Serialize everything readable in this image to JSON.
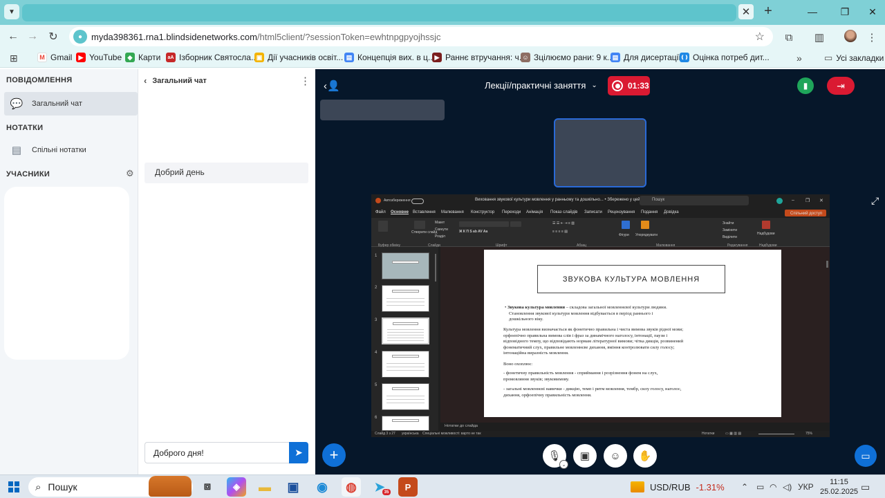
{
  "browser": {
    "tab_menu_icon": "chevron-down-icon",
    "url_host": "myda398361.rna1.blindsidenetworks.com",
    "url_path": "/html5client/?sessionToken=ewhtnpgpyojhssjc",
    "bookmarks": [
      {
        "label": "Gmail",
        "color": "#ea4335",
        "glyph": "M"
      },
      {
        "label": "YouTube",
        "color": "#ff0000",
        "glyph": "▶"
      },
      {
        "label": "Карти",
        "color": "#34a853",
        "glyph": "◆"
      },
      {
        "label": "Ізборник Святосла...",
        "color": "#c62828",
        "glyph": "aA"
      },
      {
        "label": "Дії учасників освіт...",
        "color": "#f4b400",
        "glyph": "▣"
      },
      {
        "label": "Концепція вих. в ц...",
        "color": "#4285f4",
        "glyph": "▤"
      },
      {
        "label": "Раннє втручання: ч...",
        "color": "#7b1f1f",
        "glyph": "▶"
      },
      {
        "label": "Зцілюємо рани: 9 к...",
        "color": "#8d6e63",
        "glyph": "☺"
      },
      {
        "label": "Для дисертації",
        "color": "#4285f4",
        "glyph": "▤"
      },
      {
        "label": "Оцінка потреб  дит...",
        "color": "#1e88e5",
        "glyph": "❪❫"
      }
    ],
    "all_bookmarks": "Усі закладки"
  },
  "sidebar": {
    "messages_title": "ПОВІДОМЛЕННЯ",
    "public_chat": "Загальний чат",
    "notes_title": "НОТАТКИ",
    "shared_notes": "Спільні нотатки",
    "participants_title": "УЧАСНИКИ"
  },
  "chat": {
    "title": "Загальний чат",
    "messages": [
      "Добрий день"
    ],
    "input_value": "Доброго дня!"
  },
  "meeting": {
    "room_title": "Лекції/практичні заняття",
    "recording_time": "01:33"
  },
  "powerpoint": {
    "title": "Виховання звукової культури мовлення у ранньому та дошкільно...  •  Збережено у цей ПК",
    "search": "Пошук",
    "autosave": "Автозбереження",
    "share_button": "Спільний доступ",
    "menu": [
      "Файл",
      "Основне",
      "Вставлення",
      "Малювання",
      "Конструктор",
      "Переходи",
      "Анімація",
      "Показ слайдів",
      "Записати",
      "Рецензування",
      "Подання",
      "Довідка"
    ],
    "ribbon": {
      "groups": [
        "Буфер обміну",
        "Слайди",
        "Шрифт",
        "Абзац",
        "Малювання",
        "Редагування",
        "Надбудови"
      ],
      "items": [
        "Створити слайд",
        "Макет",
        "Скинути",
        "Розділ",
        "Фігури",
        "Упорядкувати",
        "Знайти",
        "Замінити",
        "Виділити",
        "Надбудови"
      ]
    },
    "thumb_numbers": [
      "1",
      "2",
      "3",
      "4",
      "5",
      "6"
    ],
    "slide": {
      "title": "ЗВУКОВА КУЛЬТУРА МОВЛЕННЯ",
      "p1_bold": "Звукова культура мовлення",
      "p1_rest": " – складова загальної мовленнєвої культури людини. Становлення звукової культури мовлення відбувається в період раннього і дошкільного віку.",
      "p2": "Культура мовлення визначається як фонетично правильна і чиста вимова звуків рідної мови; орфоепічно правильна вимова слів і фраз за динамічного наголосу, інтонації, паузи і відповідного темпу, що відповідають нормам літературної вимови; чітка дикція, розвинений фонематичний слух, правильне мовленнєве дихання, вміння контролювати силу голосу; інтонаційна виразність мовлення.",
      "p3": "Воно охоплює:",
      "p4": "- фонетичну правильність мовлення - сприймання і розрізнення фонем на слух, промовляння звуків; звуковимову.",
      "p5": "- загальні мовленнєві навички - дикцію, темп і ритм мовлення, тембр, силу голосу, наголос, дихання, орфоепічну правильність мовлення."
    },
    "notes_label": "Нотатки до слайда",
    "status": {
      "slide": "Слайд 3 з 27",
      "lang": "українська",
      "accessibility": "Спеціальні можливості: варто не так",
      "notes": "Нотатки",
      "zoom": "75%"
    }
  },
  "taskbar": {
    "search": "Пошук",
    "ticker_label": "USD/RUB",
    "ticker_change": "-1.31%",
    "lang": "УКР",
    "time": "11:15",
    "date": "25.02.2025",
    "badge": "35"
  }
}
